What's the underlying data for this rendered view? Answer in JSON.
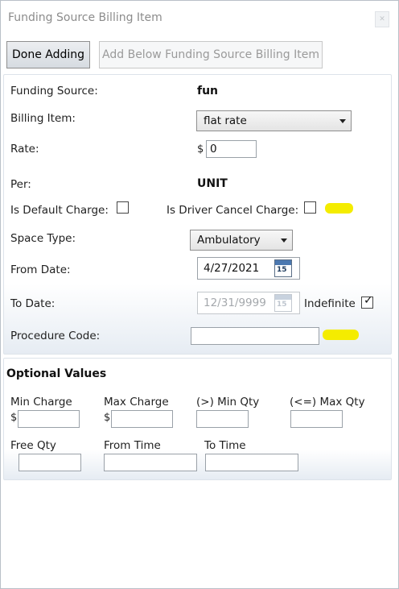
{
  "window": {
    "title": "Funding Source Billing Item",
    "close_icon": "close-icon"
  },
  "toolbar": {
    "done_label": "Done Adding",
    "add_below_label": "Add Below Funding Source Billing Item"
  },
  "form": {
    "funding_source_label": "Funding Source:",
    "funding_source_value": "fun",
    "billing_item_label": "Billing Item:",
    "billing_item_value": "flat rate",
    "rate_label": "Rate:",
    "rate_currency": "$",
    "rate_value": "0",
    "per_label": "Per:",
    "per_value": "UNIT",
    "default_charge_label": "Is Default Charge:",
    "default_charge_checked": false,
    "driver_cancel_label": "Is Driver Cancel Charge:",
    "driver_cancel_checked": false,
    "space_type_label": "Space Type:",
    "space_type_value": "Ambulatory",
    "from_date_label": "From Date:",
    "from_date_value": "4/27/2021",
    "calendar_day": "15",
    "to_date_label": "To Date:",
    "to_date_value": "12/31/9999",
    "indefinite_label": "Indefinite",
    "indefinite_checked": true,
    "procedure_code_label": "Procedure Code:",
    "procedure_code_value": ""
  },
  "optional": {
    "title": "Optional Values",
    "min_charge_label": "Min Charge",
    "max_charge_label": "Max Charge",
    "min_qty_label": "(>) Min Qty",
    "max_qty_label": "(<=) Max Qty",
    "free_qty_label": "Free Qty",
    "from_time_label": "From Time",
    "to_time_label": "To Time",
    "currency": "$"
  },
  "colors": {
    "highlight": "#f4ec00",
    "calendar_accent": "#4b78b0"
  }
}
